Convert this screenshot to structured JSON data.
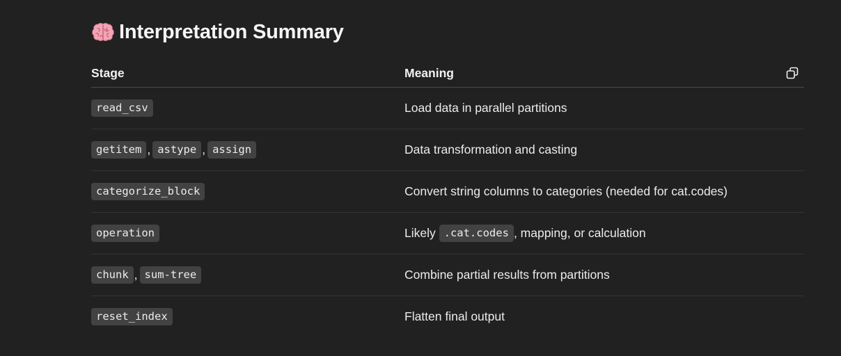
{
  "heading": {
    "emoji": "🧠",
    "title": "Interpretation Summary"
  },
  "table": {
    "columns": [
      "Stage",
      "Meaning"
    ],
    "copy_icon": "copy-icon",
    "rows": [
      {
        "stages": [
          "read_csv"
        ],
        "meaning": [
          {
            "text": "Load data in parallel partitions"
          }
        ]
      },
      {
        "stages": [
          "getitem",
          "astype",
          "assign"
        ],
        "meaning": [
          {
            "text": "Data transformation and casting"
          }
        ]
      },
      {
        "stages": [
          "categorize_block"
        ],
        "meaning": [
          {
            "text": "Convert string columns to categories (needed for cat.codes)"
          }
        ]
      },
      {
        "stages": [
          "operation"
        ],
        "meaning": [
          {
            "text": "Likely "
          },
          {
            "code": ".cat.codes"
          },
          {
            "text": ", mapping, or calculation"
          }
        ]
      },
      {
        "stages": [
          "chunk",
          "sum-tree"
        ],
        "meaning": [
          {
            "text": "Combine partial results from partitions"
          }
        ]
      },
      {
        "stages": [
          "reset_index"
        ],
        "meaning": [
          {
            "text": "Flatten final output"
          }
        ]
      }
    ]
  },
  "colors": {
    "background": "#212121",
    "text": "#ececec",
    "code_background": "#424242",
    "divider": "#343434",
    "header_divider": "#4a4a4a"
  }
}
